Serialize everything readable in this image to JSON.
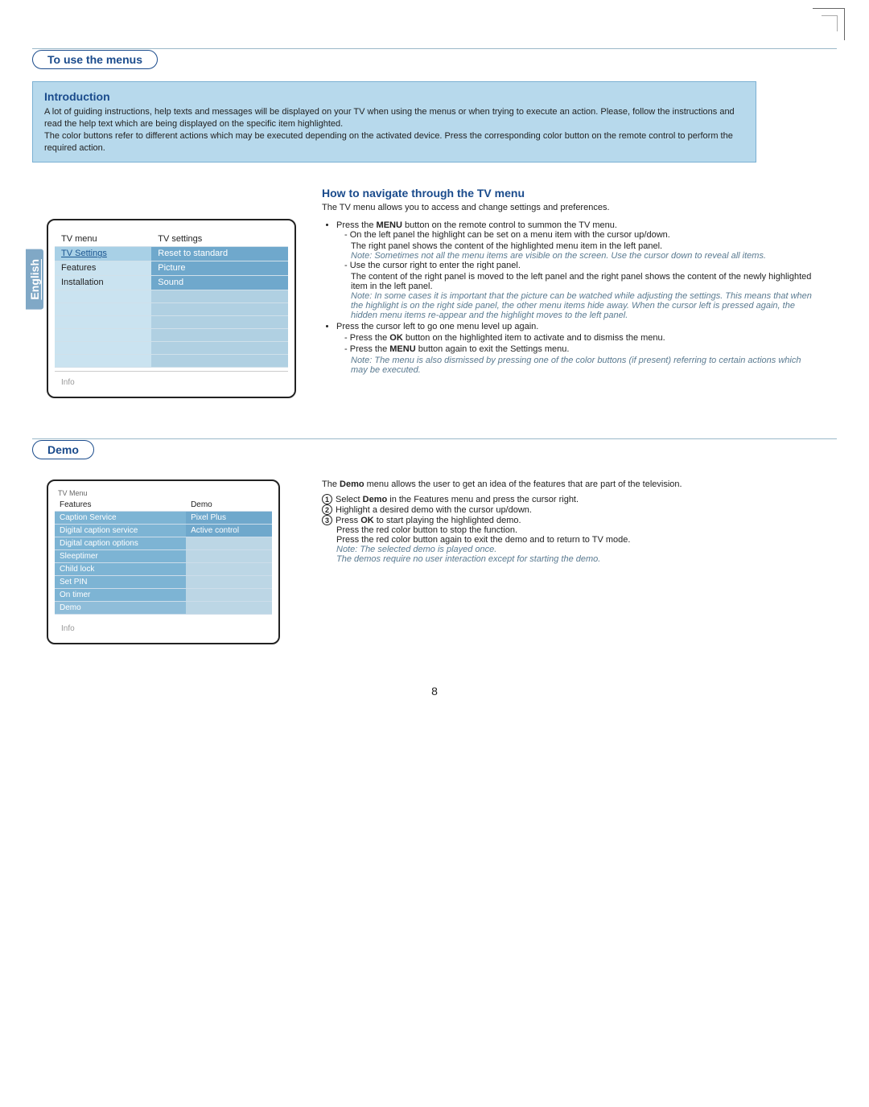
{
  "lang_tab": "English",
  "sec1": {
    "title": "To use the menus",
    "intro_h": "Introduction",
    "intro_p1": "A lot of guiding instructions, help texts and messages will be displayed on your TV when using the menus or when trying to execute an action. Please, follow the instructions and read the help text which are being displayed on the specific item highlighted.",
    "intro_p2": "The color buttons refer to different actions which may be executed depending on the activated device. Press the corresponding color button on the remote control to perform the required action."
  },
  "menu1": {
    "left_h": "TV menu",
    "right_h": "TV settings",
    "rows": [
      {
        "l": "TV Settings",
        "r": "Reset to standard"
      },
      {
        "l": "Features",
        "r": "Picture"
      },
      {
        "l": "Installation",
        "r": "Sound"
      }
    ],
    "info": "Info"
  },
  "nav": {
    "h": "How to navigate through the TV menu",
    "lead": "The TV menu allows you to access and change settings and preferences.",
    "li1": "Press the MENU button on the remote control to summon the TV menu.",
    "d1": "On the left panel the highlight can be set on a menu item with the cursor up/down.",
    "d1b": "The right panel shows the content of the highlighted menu item in the left panel.",
    "note1": "Note: Sometimes not all the menu items are visible on the screen. Use the cursor down to reveal all items.",
    "d2": "Use the cursor right to enter the right panel.",
    "d2b": "The content of the right panel is moved to the left panel and the right panel shows the content of the newly highlighted item in the left panel.",
    "note2": "Note: In some cases it is important that the picture can be watched while adjusting the settings. This means that when the highlight is on the right side panel, the other menu items hide away.  When the cursor left is pressed again, the hidden menu items re-appear and the highlight moves to the left panel.",
    "li2": "Press the cursor left to go one menu level up again.",
    "d3": "Press the OK button on the highlighted item to activate and to dismiss the menu.",
    "d4": "Press the MENU button again to exit the Settings menu.",
    "note3": "Note: The menu is also dismissed by pressing one of the color buttons (if present) referring to certain actions which may be executed."
  },
  "sec2": {
    "title": "Demo"
  },
  "menu2": {
    "top": "TV Menu",
    "left_h": "Features",
    "right_h": "Demo",
    "rows": [
      {
        "l": "Caption Service",
        "r": "Pixel Plus"
      },
      {
        "l": "Digital caption service",
        "r": "Active control"
      },
      {
        "l": "Digital caption options",
        "r": ""
      },
      {
        "l": "Sleeptimer",
        "r": ""
      },
      {
        "l": "Child lock",
        "r": ""
      },
      {
        "l": "Set PIN",
        "r": ""
      },
      {
        "l": "On timer",
        "r": ""
      },
      {
        "l": "Demo",
        "r": ""
      }
    ],
    "info": "Info"
  },
  "demo": {
    "lead": "The Demo menu allows the user to get an idea of the features that are part of the television.",
    "s1": "Select Demo in the Features menu and press the cursor right.",
    "s2": "Highlight a desired demo with the cursor up/down.",
    "s3a": "Press OK to start playing the highlighted demo.",
    "s3b": "Press the red color button to stop the function.",
    "s3c": "Press the red color button again to exit the demo and to return to TV mode.",
    "note1": "Note: The selected demo is played once.",
    "note2": "The demos require no user interaction except for starting the demo."
  },
  "page_num": "8"
}
